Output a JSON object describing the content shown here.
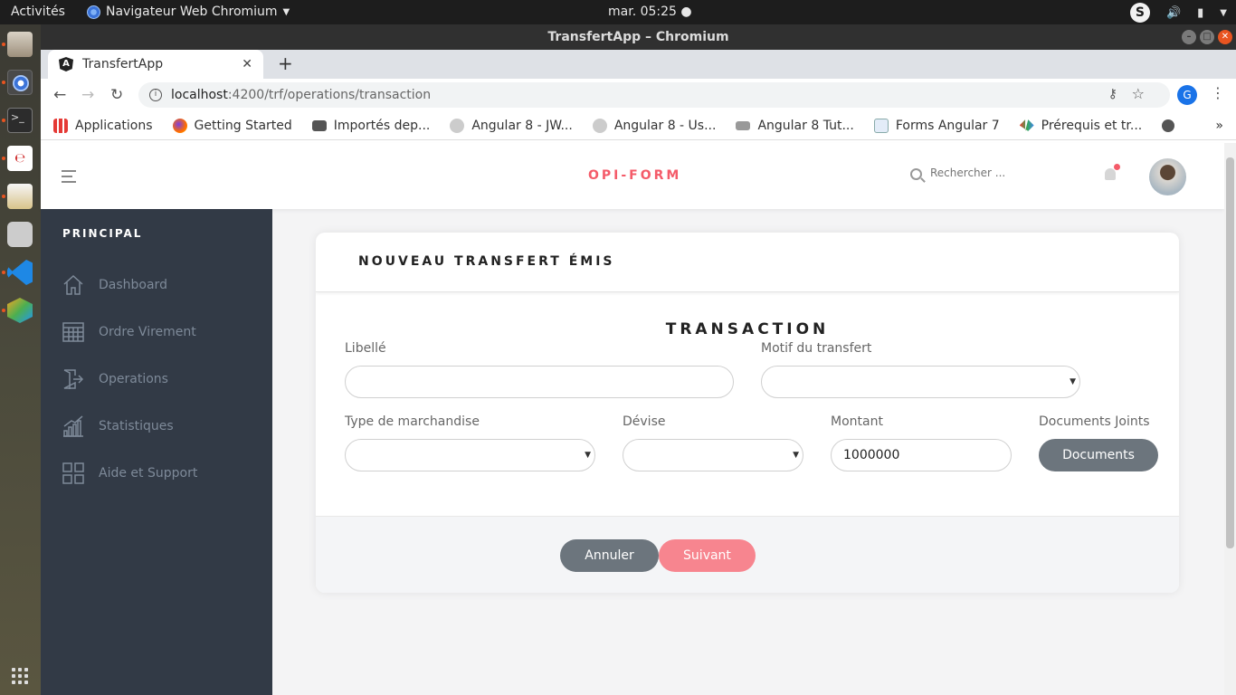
{
  "system": {
    "activities": "Activités",
    "app_menu": "Navigateur Web Chromium",
    "clock": "mar. 05:25"
  },
  "window": {
    "title": "TransfertApp – Chromium"
  },
  "browser": {
    "tab_title": "TransfertApp",
    "url_host": "localhost",
    "url_path": ":4200/trf/operations/transaction",
    "profile_initial": "G",
    "bookmarks": [
      {
        "label": "Applications",
        "icon": "apps-grid-icon"
      },
      {
        "label": "Getting Started",
        "icon": "firefox-icon"
      },
      {
        "label": "Importés dep...",
        "icon": "folder-icon"
      },
      {
        "label": "Angular 8 - JW...",
        "icon": "avatar-icon"
      },
      {
        "label": "Angular 8 - Us...",
        "icon": "avatar-icon"
      },
      {
        "label": "Angular 8 Tut...",
        "icon": "page-icon"
      },
      {
        "label": "Forms Angular 7",
        "icon": "doc-icon"
      },
      {
        "label": "Prérequis et tr...",
        "icon": "code-icon"
      }
    ]
  },
  "header": {
    "brand": "OPI-FORM",
    "search_placeholder": "Rechercher ..."
  },
  "sidebar": {
    "title": "PRINCIPAL",
    "items": [
      {
        "label": "Dashboard",
        "icon": "home-icon"
      },
      {
        "label": "Ordre Virement",
        "icon": "table-icon"
      },
      {
        "label": "Operations",
        "icon": "exit-icon"
      },
      {
        "label": "Statistiques",
        "icon": "bar-chart-icon"
      },
      {
        "label": "Aide et Support",
        "icon": "grid-icon"
      }
    ]
  },
  "card": {
    "title": "NOUVEAU TRANSFERT ÉMIS",
    "section": "TRANSACTION",
    "fields": {
      "libelle_label": "Libellé",
      "libelle_value": "",
      "motif_label": "Motif du transfert",
      "motif_value": "",
      "type_label": "Type de marchandise",
      "type_value": "",
      "devise_label": "Dévise",
      "devise_value": "",
      "montant_label": "Montant",
      "montant_value": "1000000",
      "docs_label": "Documents Joints",
      "docs_button": "Documents"
    },
    "cancel_button": "Annuler",
    "next_button": "Suivant"
  },
  "colors": {
    "brand": "#f45b69",
    "sidebar_bg": "#323a46",
    "secondary_button": "#6c757d",
    "primary_button": "#f7858f"
  }
}
